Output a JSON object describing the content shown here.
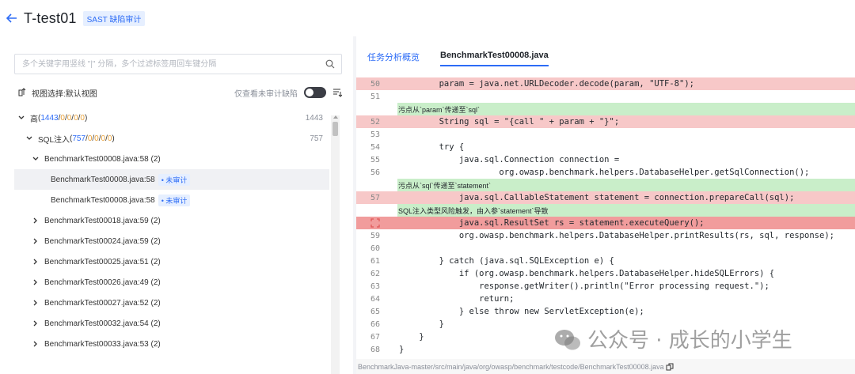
{
  "header": {
    "title": "T-test01",
    "tag": "SAST 缺陷审计"
  },
  "left": {
    "search_placeholder": "多个关键字用竖线 \"|\" 分隔，多个过滤标签用回车键分隔",
    "view_label": "视图选择:默认视图",
    "only_unaudited_label": "仅查看未审计缺陷",
    "tree": [
      {
        "label": "高",
        "counts": [
          "1443",
          "0",
          "0",
          "0",
          "0"
        ],
        "total": "1443",
        "level": 0,
        "expanded": true
      },
      {
        "label": "SQL注入",
        "counts": [
          "757",
          "0",
          "0",
          "0",
          "0"
        ],
        "total": "757",
        "level": 1,
        "expanded": true
      },
      {
        "label": "BenchmarkTest00008.java:58 (2)",
        "level": 2,
        "expanded": true
      },
      {
        "label": "BenchmarkTest00008.java:58",
        "badge": "• 未审计",
        "level": 3,
        "selected": true
      },
      {
        "label": "BenchmarkTest00008.java:58",
        "badge": "• 未审计",
        "level": 3
      },
      {
        "label": "BenchmarkTest00018.java:59 (2)",
        "level": 2
      },
      {
        "label": "BenchmarkTest00024.java:59 (2)",
        "level": 2
      },
      {
        "label": "BenchmarkTest00025.java:51 (2)",
        "level": 2
      },
      {
        "label": "BenchmarkTest00026.java:49 (2)",
        "level": 2
      },
      {
        "label": "BenchmarkTest00027.java:52 (2)",
        "level": 2
      },
      {
        "label": "BenchmarkTest00032.java:54 (2)",
        "level": 2
      },
      {
        "label": "BenchmarkTest00033.java:53 (2)",
        "level": 2
      }
    ]
  },
  "right": {
    "tabs": [
      "任务分析概览",
      "BenchmarkTest00008.java"
    ],
    "code_lines": [
      {
        "n": "50",
        "t": "        param = java.net.URLDecoder.decode(param, \"UTF-8\");",
        "hl": "red"
      },
      {
        "n": "51",
        "t": ""
      },
      {
        "note": "污点从`param`传递至`sql`"
      },
      {
        "n": "52",
        "t": "        String sql = \"{call \" + param + \"}\";",
        "hl": "red"
      },
      {
        "n": "53",
        "t": ""
      },
      {
        "n": "54",
        "t": "        try {"
      },
      {
        "n": "55",
        "t": "            java.sql.Connection connection ="
      },
      {
        "n": "56",
        "t": "                    org.owasp.benchmark.helpers.DatabaseHelper.getSqlConnection();"
      },
      {
        "note": "污点从`sql`传递至`statement`"
      },
      {
        "n": "57",
        "t": "            java.sql.CallableStatement statement = connection.prepareCall(sql);",
        "hl": "red"
      },
      {
        "note": "SQL注入类型风险触发，由入参`statement`导致"
      },
      {
        "n": "",
        "t": "            java.sql.ResultSet rs = statement.executeQuery();",
        "hl": "red2",
        "marker": true
      },
      {
        "n": "59",
        "t": "            org.owasp.benchmark.helpers.DatabaseHelper.printResults(rs, sql, response);"
      },
      {
        "n": "60",
        "t": ""
      },
      {
        "n": "61",
        "t": "        } catch (java.sql.SQLException e) {"
      },
      {
        "n": "62",
        "t": "            if (org.owasp.benchmark.helpers.DatabaseHelper.hideSQLErrors) {"
      },
      {
        "n": "63",
        "t": "                response.getWriter().println(\"Error processing request.\");"
      },
      {
        "n": "64",
        "t": "                return;"
      },
      {
        "n": "65",
        "t": "            } else throw new ServletException(e);"
      },
      {
        "n": "66",
        "t": "        }"
      },
      {
        "n": "67",
        "t": "    }"
      },
      {
        "n": "68",
        "t": "}"
      }
    ],
    "path": "BenchmarkJava-master/src/main/java/org/owasp/benchmark/testcode/BenchmarkTest00008.java"
  },
  "watermark": "公众号 · 成长的小学生",
  "colors": {
    "accent": "#2d6cf6",
    "risk_orange": "#e8a23d",
    "highlight_red": "#f7c8c8",
    "note_green": "#c9eec9"
  }
}
